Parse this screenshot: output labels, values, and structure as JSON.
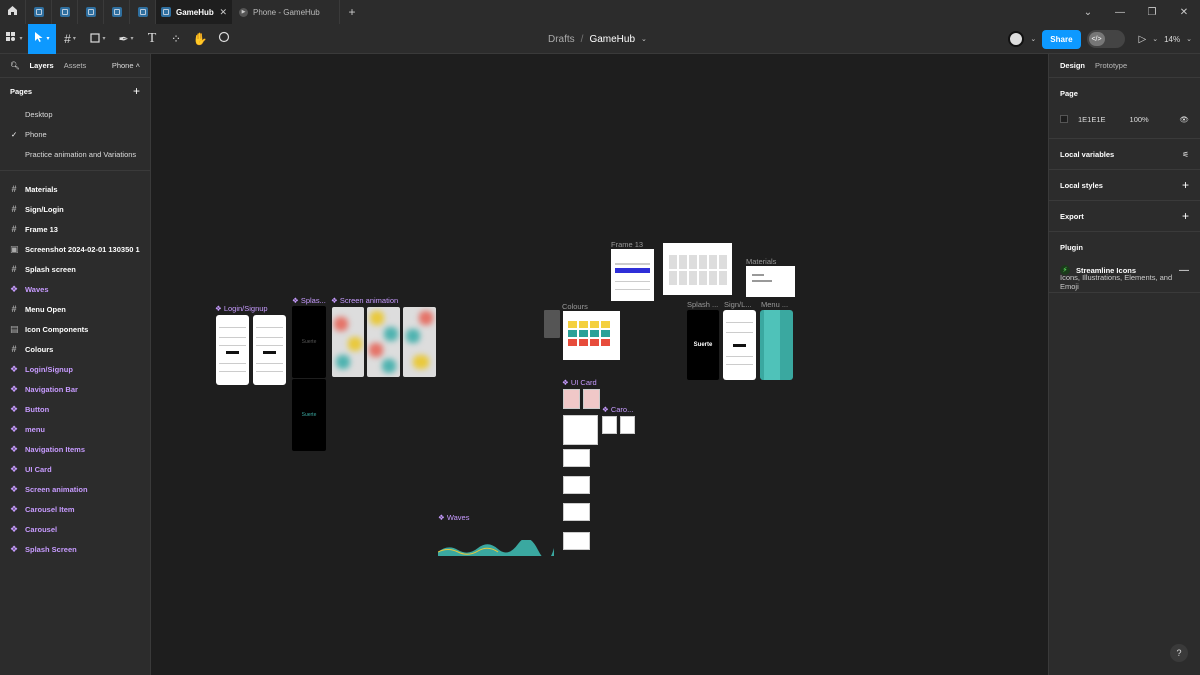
{
  "tabs": {
    "active_label": "GameHub",
    "proto_label": "Phone - GameHub"
  },
  "breadcrumb": {
    "drafts": "Drafts",
    "separator": "/",
    "file": "GameHub"
  },
  "toolbar": {
    "share_label": "Share",
    "zoom": "14%"
  },
  "left_panel": {
    "tab_layers": "Layers",
    "tab_assets": "Assets",
    "page_selector": "Phone",
    "pages_title": "Pages",
    "pages": [
      "Desktop",
      "Phone",
      "Practice animation and Variations"
    ],
    "current_page": "Phone",
    "layers": [
      {
        "label": "Materials",
        "type": "frame"
      },
      {
        "label": "Sign/Login",
        "type": "frame"
      },
      {
        "label": "Frame 13",
        "type": "frame"
      },
      {
        "label": "Screenshot 2024-02-01 130350 1",
        "type": "image"
      },
      {
        "label": "Splash screen",
        "type": "frame"
      },
      {
        "label": "Waves",
        "type": "component"
      },
      {
        "label": "Menu Open",
        "type": "frame"
      },
      {
        "label": "Icon Components",
        "type": "section"
      },
      {
        "label": "Colours",
        "type": "frame"
      },
      {
        "label": "Login/Signup",
        "type": "component"
      },
      {
        "label": "Navigation Bar",
        "type": "component"
      },
      {
        "label": "Button",
        "type": "component"
      },
      {
        "label": "menu",
        "type": "component"
      },
      {
        "label": "Navigation Items",
        "type": "component"
      },
      {
        "label": "UI Card",
        "type": "component"
      },
      {
        "label": "Screen animation",
        "type": "component"
      },
      {
        "label": "Carousel Item",
        "type": "component"
      },
      {
        "label": "Carousel",
        "type": "component"
      },
      {
        "label": "Splash Screen",
        "type": "component"
      }
    ]
  },
  "right_panel": {
    "tab_design": "Design",
    "tab_prototype": "Prototype",
    "page_title": "Page",
    "page_color": "1E1E1E",
    "page_opacity": "100%",
    "local_variables": "Local variables",
    "local_styles": "Local styles",
    "export": "Export",
    "plugin_title": "Plugin",
    "plugin_name": "Streamline Icons",
    "plugin_desc": "Icons, Illustrations, Elements, and Emoji"
  },
  "canvas": {
    "login_signup": "Login/Signup",
    "splash": "Splas...",
    "screen_animation": "Screen animation",
    "colours": "Colours",
    "frame13": "Frame 13",
    "materials": "Materials",
    "splash2": "Splash ...",
    "signl": "Sign/L...",
    "menu": "Menu ...",
    "ui_card": "UI Card",
    "caro": "Caro...",
    "waves": "Waves",
    "suerte": "Suerte",
    "suerte2": "Suerte"
  },
  "colors": {
    "accent": "#0d99ff",
    "component": "#c79bff",
    "canvas": "#1e1e1e",
    "panel": "#2c2c2c",
    "teal": "#3aa8a0"
  }
}
